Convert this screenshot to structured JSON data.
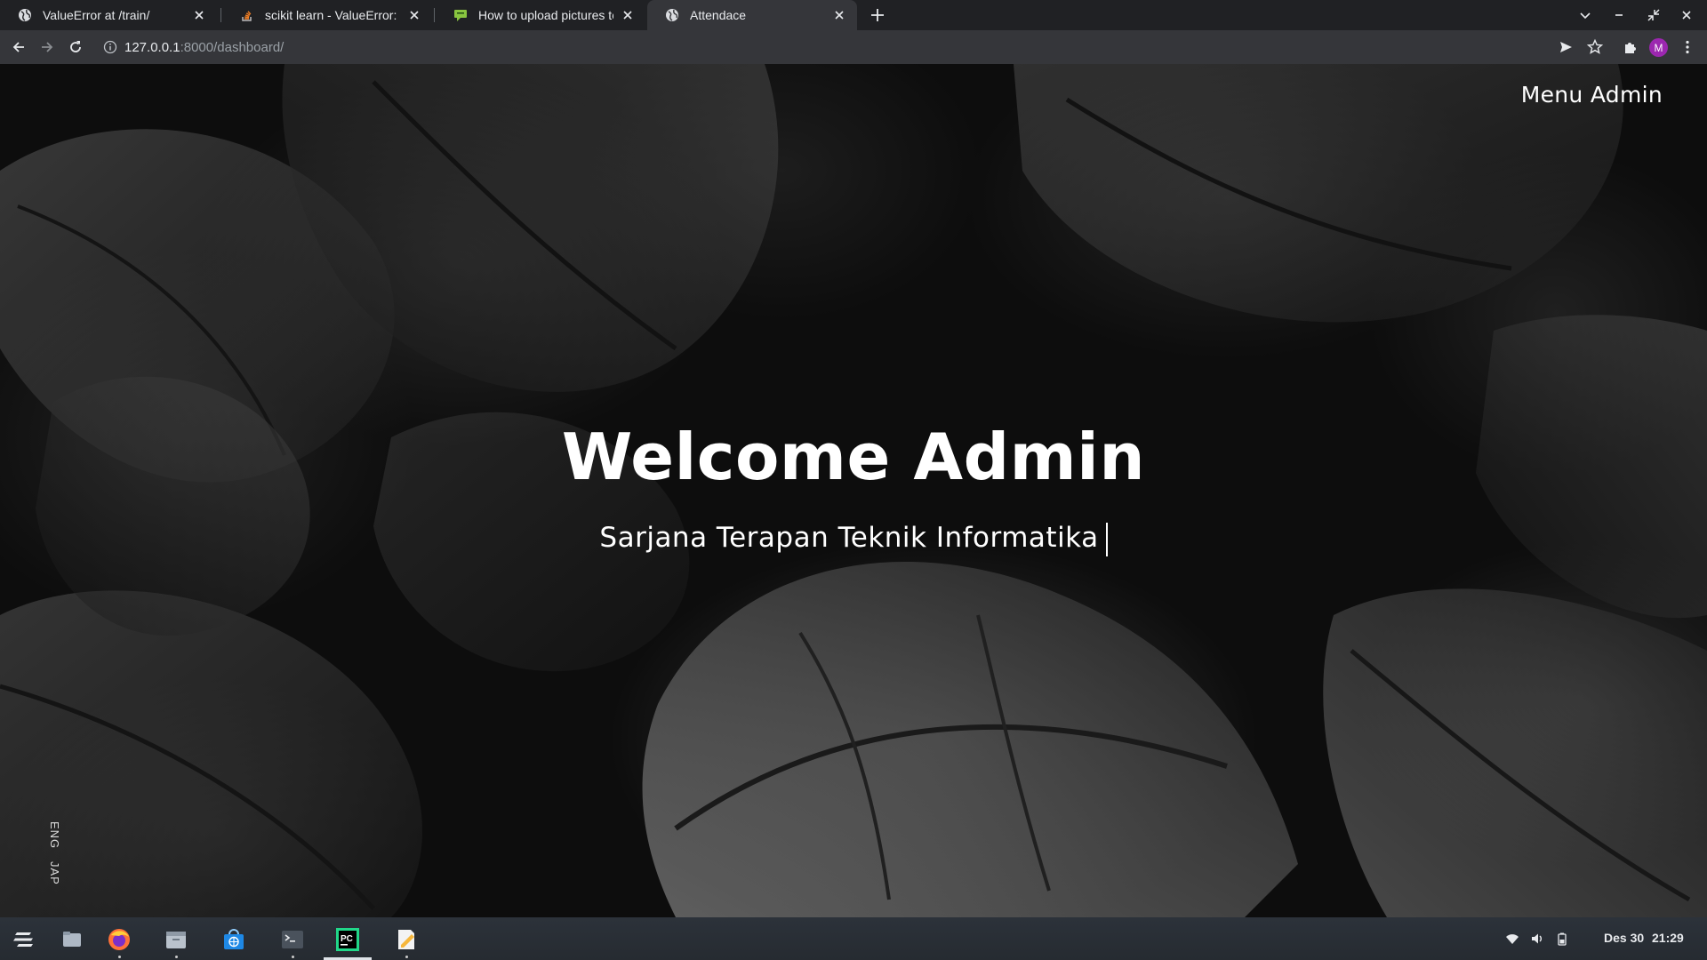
{
  "browser": {
    "tabs": [
      {
        "title": "ValueError at /train/",
        "favicon": "globe-icon",
        "active": false
      },
      {
        "title": "scikit learn - ValueError: The",
        "favicon": "stackoverflow-icon",
        "active": false
      },
      {
        "title": "How to upload pictures to r",
        "favicon": "chat-icon",
        "active": false
      },
      {
        "title": "Attendace",
        "favicon": "globe-icon",
        "active": true
      }
    ],
    "url_host": "127.0.0.1",
    "url_path": ":8000/dashboard/",
    "profile_initial": "M"
  },
  "page": {
    "menu_label": "Menu Admin",
    "hero_title": "Welcome Admin",
    "hero_subtitle": "Sarjana Terapan Teknik Informatika",
    "languages": [
      "ENG",
      "JAP"
    ]
  },
  "taskbar": {
    "apps": [
      "zorin-menu-icon",
      "files-desktop-icon",
      "firefox-icon",
      "file-manager-icon",
      "software-store-icon",
      "terminal-icon",
      "pycharm-icon",
      "text-editor-icon"
    ],
    "clock_date": "Des 30",
    "clock_time": "21:29"
  },
  "colors": {
    "tab_strip": "#202124",
    "toolbar": "#35363a",
    "page_bg": "#0d0d0d",
    "avatar": "#9c27b0",
    "pycharm": "#21d789"
  }
}
